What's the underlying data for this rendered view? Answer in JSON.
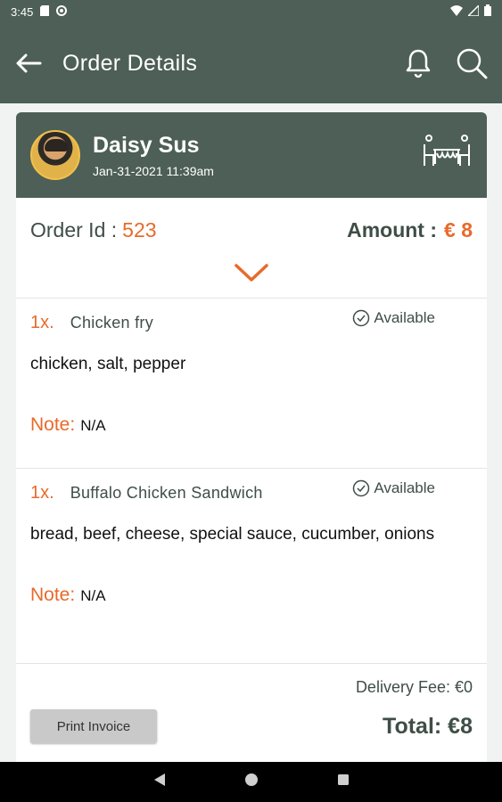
{
  "status_bar": {
    "time": "3:45"
  },
  "app_bar": {
    "title": "Order Details"
  },
  "customer": {
    "name": "Daisy Sus",
    "date": "Jan-31-2021 11:39am"
  },
  "order": {
    "id_label": "Order Id :",
    "id_value": "523",
    "amount_label": "Amount :",
    "amount_value": "€ 8"
  },
  "items": [
    {
      "qty": "1x.",
      "name": "Chicken fry",
      "status": "Available",
      "ingredients": "chicken, salt, pepper",
      "note_label": "Note:",
      "note_value": "N/A"
    },
    {
      "qty": "1x.",
      "name": "Buffalo Chicken Sandwich",
      "status": "Available",
      "ingredients": "bread, beef, cheese, special sauce, cucumber, onions",
      "note_label": "Note:",
      "note_value": "N/A"
    }
  ],
  "summary": {
    "delivery_fee": "Delivery Fee: €0",
    "print_label": "Print Invoice",
    "total": "Total:  €8"
  },
  "colors": {
    "primary": "#4d5f57",
    "accent": "#e86a2a"
  }
}
